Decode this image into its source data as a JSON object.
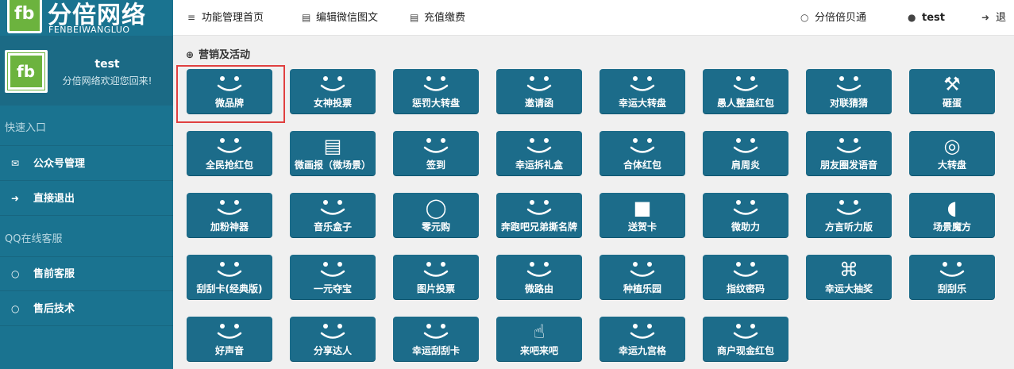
{
  "brand": {
    "logo_letters": "fb",
    "name": "分倍网络",
    "sub": "FENBEIWANGLUO"
  },
  "profile": {
    "username": "test",
    "welcome": "分倍网络欢迎您回来!"
  },
  "sidebar": {
    "section1": "快速入口",
    "items1": [
      {
        "label": "公众号管理",
        "icon": "comments-icon"
      },
      {
        "label": "直接退出",
        "icon": "sign-out-icon"
      }
    ],
    "section2": "QQ在线客服",
    "items2": [
      {
        "label": "售前客服",
        "icon": "chat-icon"
      },
      {
        "label": "售后技术",
        "icon": "chat-icon"
      }
    ]
  },
  "topbar": {
    "nav": [
      {
        "label": "功能管理首页",
        "icon": "list-indent-icon"
      },
      {
        "label": "编辑微信图文",
        "icon": "document-icon"
      },
      {
        "label": "充值缴费",
        "icon": "document-icon"
      }
    ],
    "right": [
      {
        "label": "分倍倍贝通",
        "icon": "chat-icon"
      },
      {
        "label": "test",
        "icon": "user-icon"
      },
      {
        "label": "退",
        "icon": "sign-out-icon"
      }
    ]
  },
  "main": {
    "section_title": "营销及活动",
    "tiles": [
      {
        "label": "微品牌",
        "icon": "smile"
      },
      {
        "label": "女神投票",
        "icon": "smile"
      },
      {
        "label": "惩罚大转盘",
        "icon": "smile"
      },
      {
        "label": "邀请函",
        "icon": "smile"
      },
      {
        "label": "幸运大转盘",
        "icon": "smile"
      },
      {
        "label": "愚人整蛊红包",
        "icon": "smile"
      },
      {
        "label": "对联猜猜",
        "icon": "smile"
      },
      {
        "label": "砸蛋",
        "icon": "hammer-icon"
      },
      {
        "label": "全民抢红包",
        "icon": "smile"
      },
      {
        "label": "微画报（微场景）",
        "icon": "newspaper-icon"
      },
      {
        "label": "签到",
        "icon": "smile"
      },
      {
        "label": "幸运拆礼盒",
        "icon": "smile"
      },
      {
        "label": "合体红包",
        "icon": "smile"
      },
      {
        "label": "肩周炎",
        "icon": "smile"
      },
      {
        "label": "朋友圈发语音",
        "icon": "smile"
      },
      {
        "label": "大转盘",
        "icon": "life-ring-icon"
      },
      {
        "label": "加粉神器",
        "icon": "smile"
      },
      {
        "label": "音乐盒子",
        "icon": "smile"
      },
      {
        "label": "零元购",
        "icon": "speech-bubble-icon"
      },
      {
        "label": "奔跑吧兄弟撕名牌",
        "icon": "smile"
      },
      {
        "label": "送贺卡",
        "icon": "card-icon"
      },
      {
        "label": "微助力",
        "icon": "smile"
      },
      {
        "label": "方言听力版",
        "icon": "smile"
      },
      {
        "label": "场景魔方",
        "icon": "leaf-icon"
      },
      {
        "label": "刮刮卡(经典版)",
        "icon": "smile"
      },
      {
        "label": "一元夺宝",
        "icon": "smile"
      },
      {
        "label": "图片投票",
        "icon": "smile"
      },
      {
        "label": "微路由",
        "icon": "smile"
      },
      {
        "label": "种植乐园",
        "icon": "smile"
      },
      {
        "label": "指纹密码",
        "icon": "smile"
      },
      {
        "label": "幸运大抽奖",
        "icon": "gift-icon"
      },
      {
        "label": "刮刮乐",
        "icon": "smile"
      },
      {
        "label": "好声音",
        "icon": "smile"
      },
      {
        "label": "分享达人",
        "icon": "smile"
      },
      {
        "label": "幸运刮刮卡",
        "icon": "smile"
      },
      {
        "label": "来吧来吧",
        "icon": "thumbs-up-icon"
      },
      {
        "label": "幸运九宫格",
        "icon": "smile"
      },
      {
        "label": "商户现金红包",
        "icon": "smile"
      }
    ]
  },
  "colors": {
    "sidebar": "#1a7390",
    "tile": "#1c6c8a",
    "accent_green": "#6cb33e",
    "highlight": "#e04040"
  }
}
